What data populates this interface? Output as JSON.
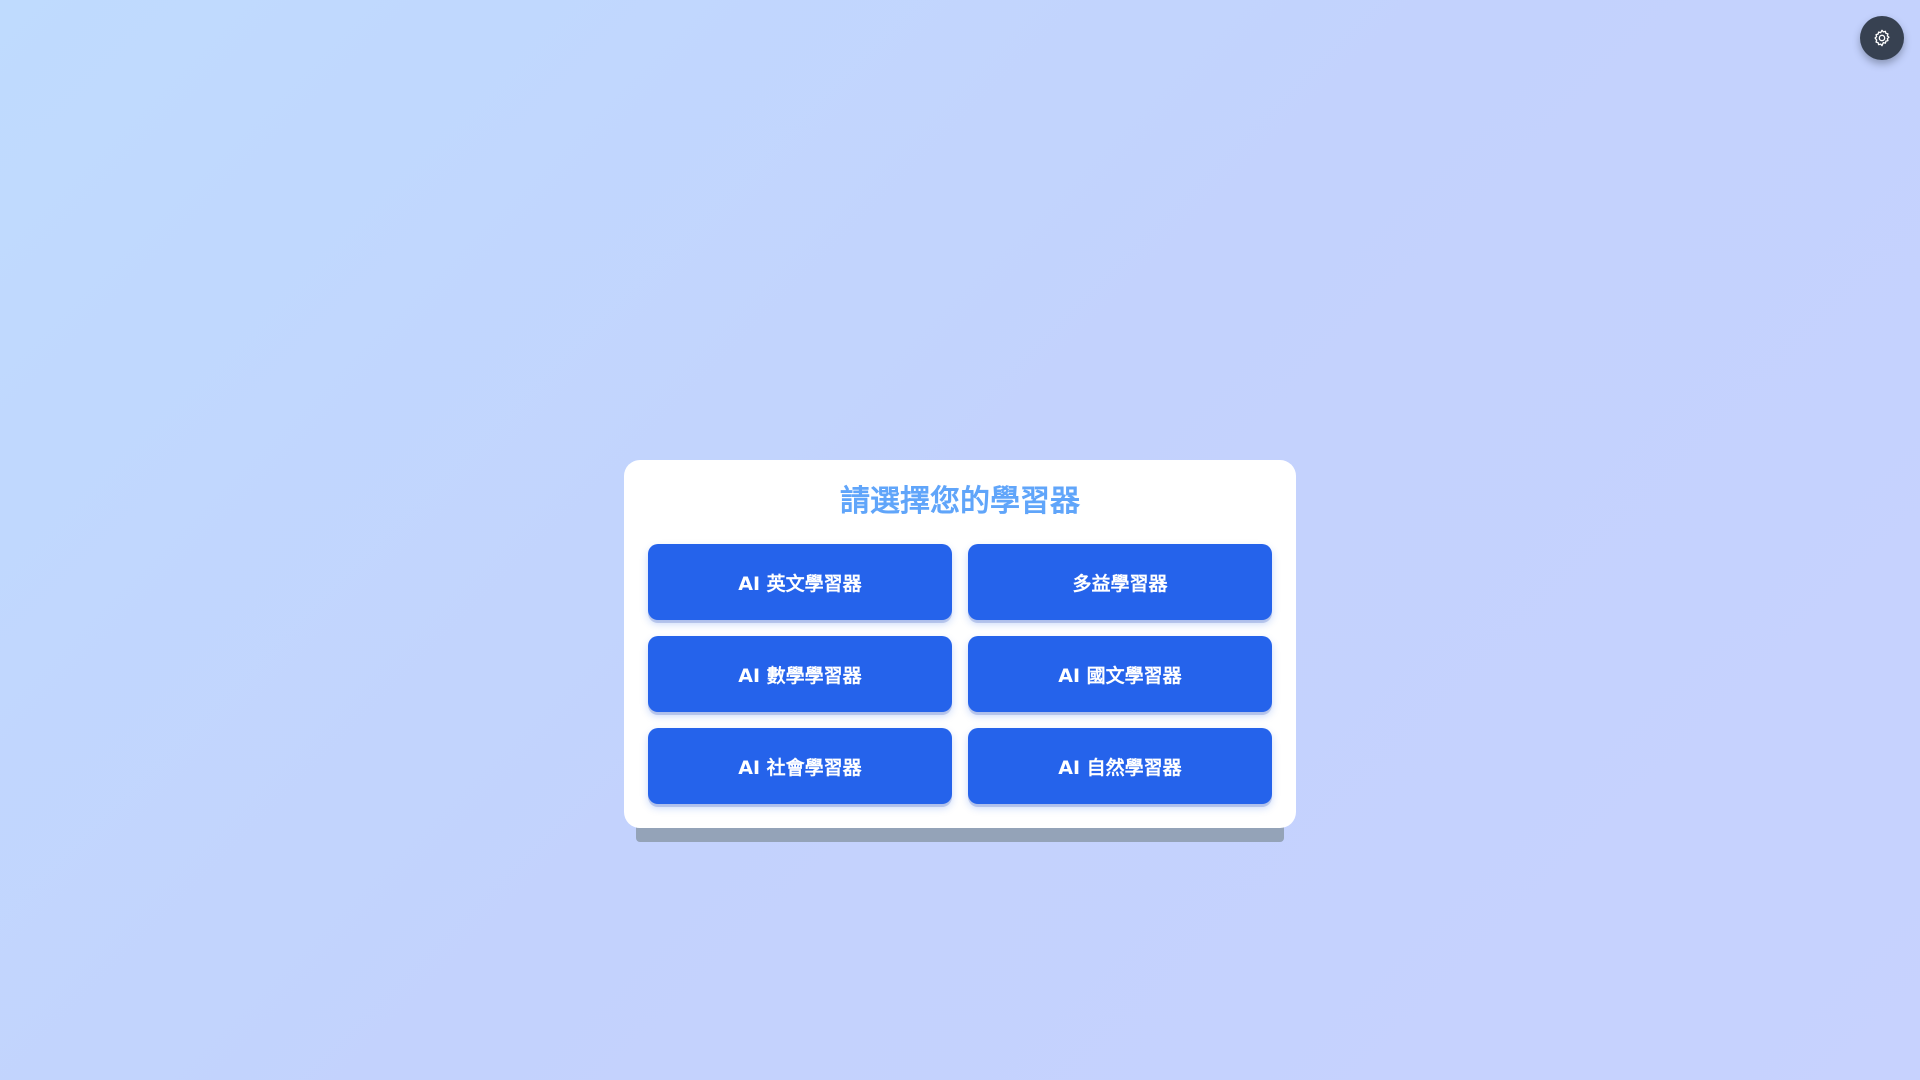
{
  "settings": {
    "icon": "gear-icon"
  },
  "selector": {
    "title": "請選擇您的學習器",
    "buttons": [
      {
        "label": "AI 英文學習器"
      },
      {
        "label": "多益學習器"
      },
      {
        "label": "AI 數學學習器"
      },
      {
        "label": "AI 國文學習器"
      },
      {
        "label": "AI 社會學習器"
      },
      {
        "label": "AI 自然學習器"
      }
    ]
  },
  "colors": {
    "accent": "#2563eb",
    "title": "#60a5fa",
    "settings_bg": "#374151"
  }
}
